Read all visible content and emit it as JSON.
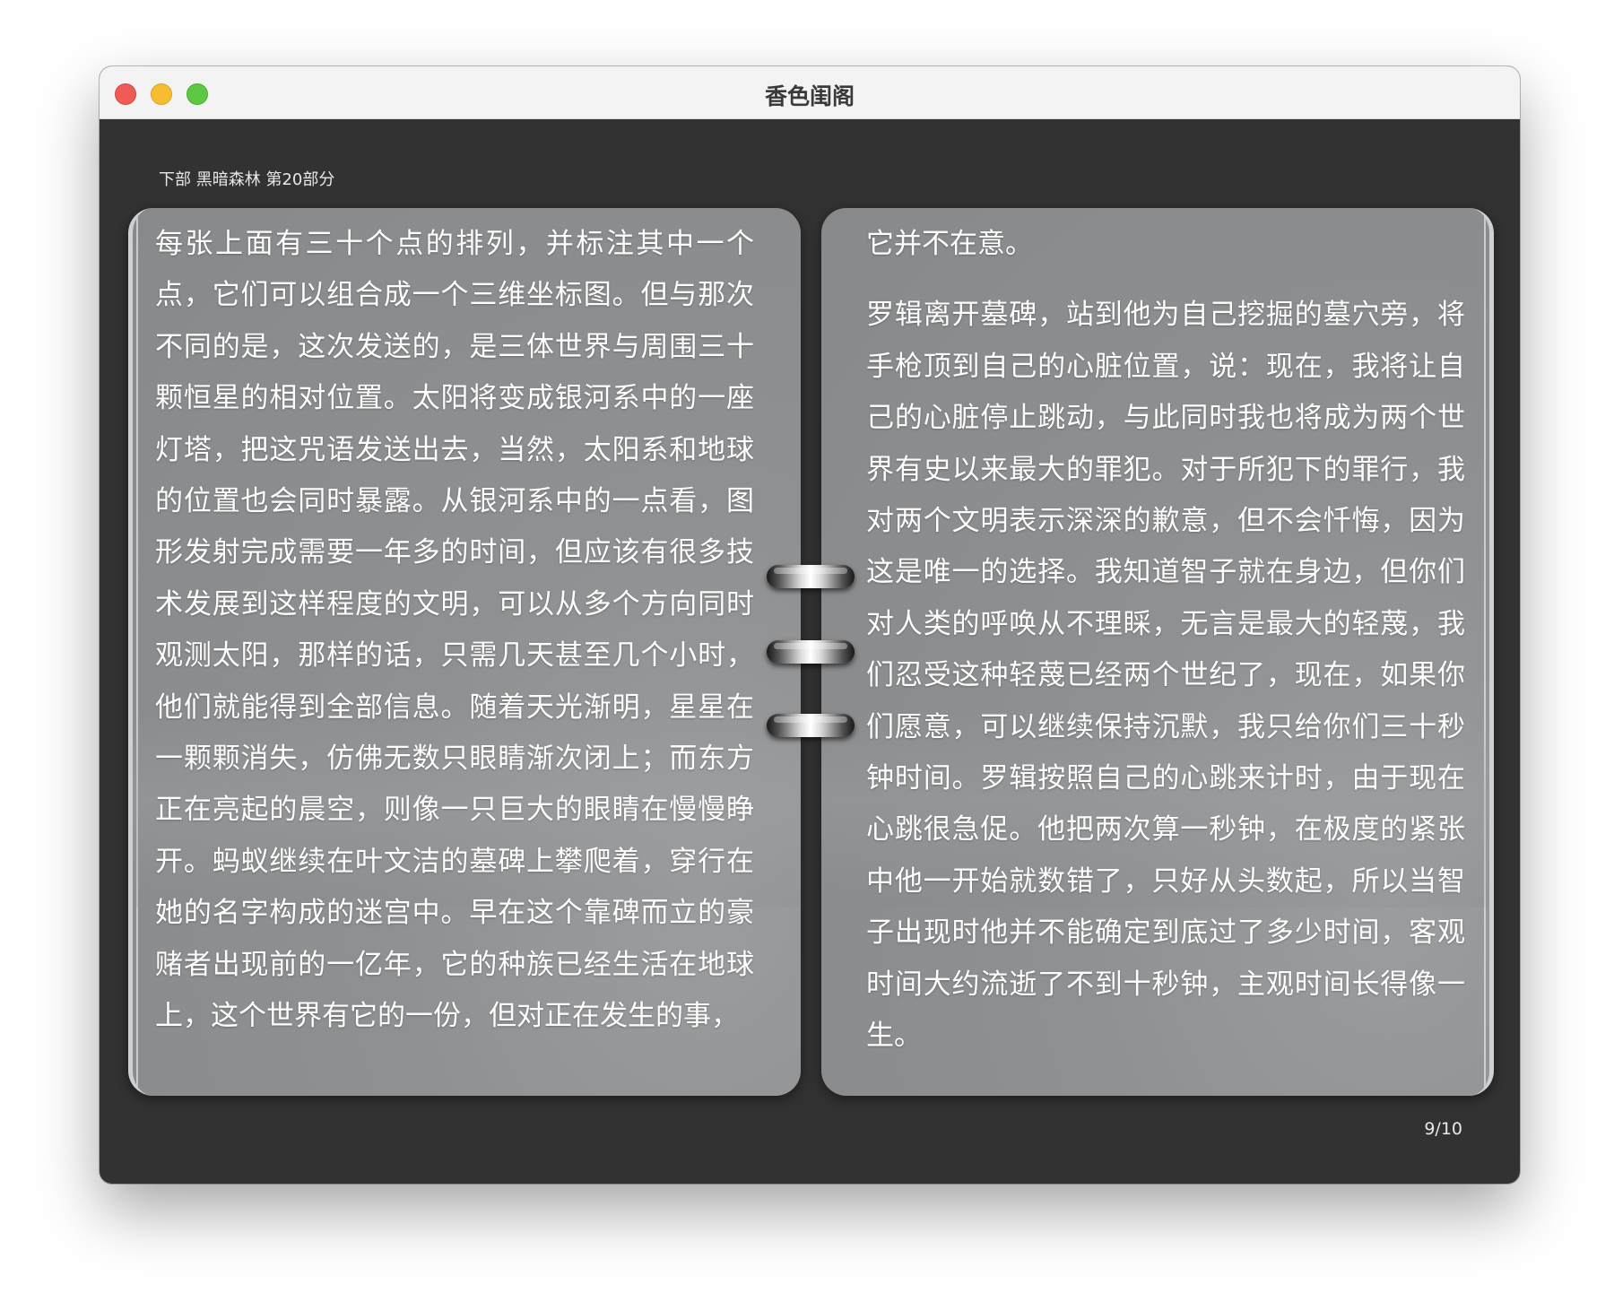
{
  "window": {
    "title": "香色闺阁"
  },
  "reader": {
    "chapter": "下部 黑暗森林 第20部分",
    "page_indicator": "9/10",
    "left_page": {
      "paragraphs": [
        "每张上面有三十个点的排列，并标注其中一个点，它们可以组合成一个三维坐标图。但与那次不同的是，这次发送的，是三体世界与周围三十颗恒星的相对位置。太阳将变成银河系中的一座灯塔，把这咒语发送出去，当然，太阳系和地球的位置也会同时暴露。从银河系中的一点看，图形发射完成需要一年多的时间，但应该有很多技术发展到这样程度的文明，可以从多个方向同时观测太阳，那样的话，只需几天甚至几个小时，他们就能得到全部信息。随着天光渐明，星星在一颗颗消失，仿佛无数只眼睛渐次闭上；而东方正在亮起的晨空，则像一只巨大的眼睛在慢慢睁开。蚂蚁继续在叶文洁的墓碑上攀爬着，穿行在她的名字构成的迷宫中。早在这个靠碑而立的豪赌者出现前的一亿年，它的种族已经生活在地球上，这个世界有它的一份，但对正在发生的事，"
      ]
    },
    "right_page": {
      "paragraphs": [
        "它并不在意。",
        "罗辑离开墓碑，站到他为自己挖掘的墓穴旁，将手枪顶到自己的心脏位置，说：现在，我将让自己的心脏停止跳动，与此同时我也将成为两个世界有史以来最大的罪犯。对于所犯下的罪行，我对两个文明表示深深的歉意，但不会忏悔，因为这是唯一的选择。我知道智子就在身边，但你们对人类的呼唤从不理睬，无言是最大的轻蔑，我们忍受这种轻蔑已经两个世纪了，现在，如果你们愿意，可以继续保持沉默，我只给你们三十秒钟时间。罗辑按照自己的心跳来计时，由于现在心跳很急促。他把两次算一秒钟，在极度的紧张中他一开始就数错了，只好从头数起，所以当智子出现时他并不能确定到底过了多少时间，客观时间大约流逝了不到十秒钟，主观时间长得像一生。"
      ]
    }
  }
}
